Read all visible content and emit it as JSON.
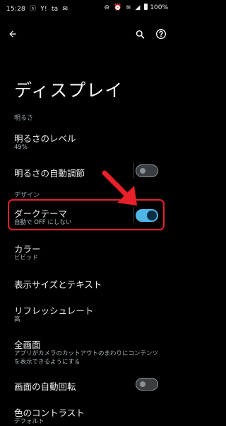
{
  "status_bar": {
    "time": "15:28",
    "left_icons": [
      "ⓢ",
      "Y!",
      "ta",
      "✉"
    ],
    "right_icons": [
      "⊖",
      "⏰",
      "≋",
      "◢"
    ],
    "battery": "100%"
  },
  "title": "ディスプレイ",
  "sections": {
    "brightness": "明るさ",
    "design": "デザイン"
  },
  "items": {
    "brightness_level": {
      "title": "明るさのレベル",
      "sub": "49%"
    },
    "auto_brightness": {
      "title": "明るさの自動調節",
      "toggle": false
    },
    "dark_theme": {
      "title": "ダークテーマ",
      "sub": "自動で OFF にしない",
      "toggle": true
    },
    "color": {
      "title": "カラー",
      "sub": "ビビッド"
    },
    "display_size": {
      "title": "表示サイズとテキスト"
    },
    "refresh_rate": {
      "title": "リフレッシュレート",
      "sub": "高"
    },
    "full_screen": {
      "title": "全画面",
      "sub": "アプリがカメラのカットアウトのまわりにコンテンツを表示できるようにする"
    },
    "auto_rotate": {
      "title": "画面の自動回転",
      "toggle": false
    },
    "contrast": {
      "title": "色のコントラスト",
      "sub": "デフォルト"
    }
  },
  "colors": {
    "accent": "#4fb6e8",
    "annotation": "#e8202a"
  }
}
